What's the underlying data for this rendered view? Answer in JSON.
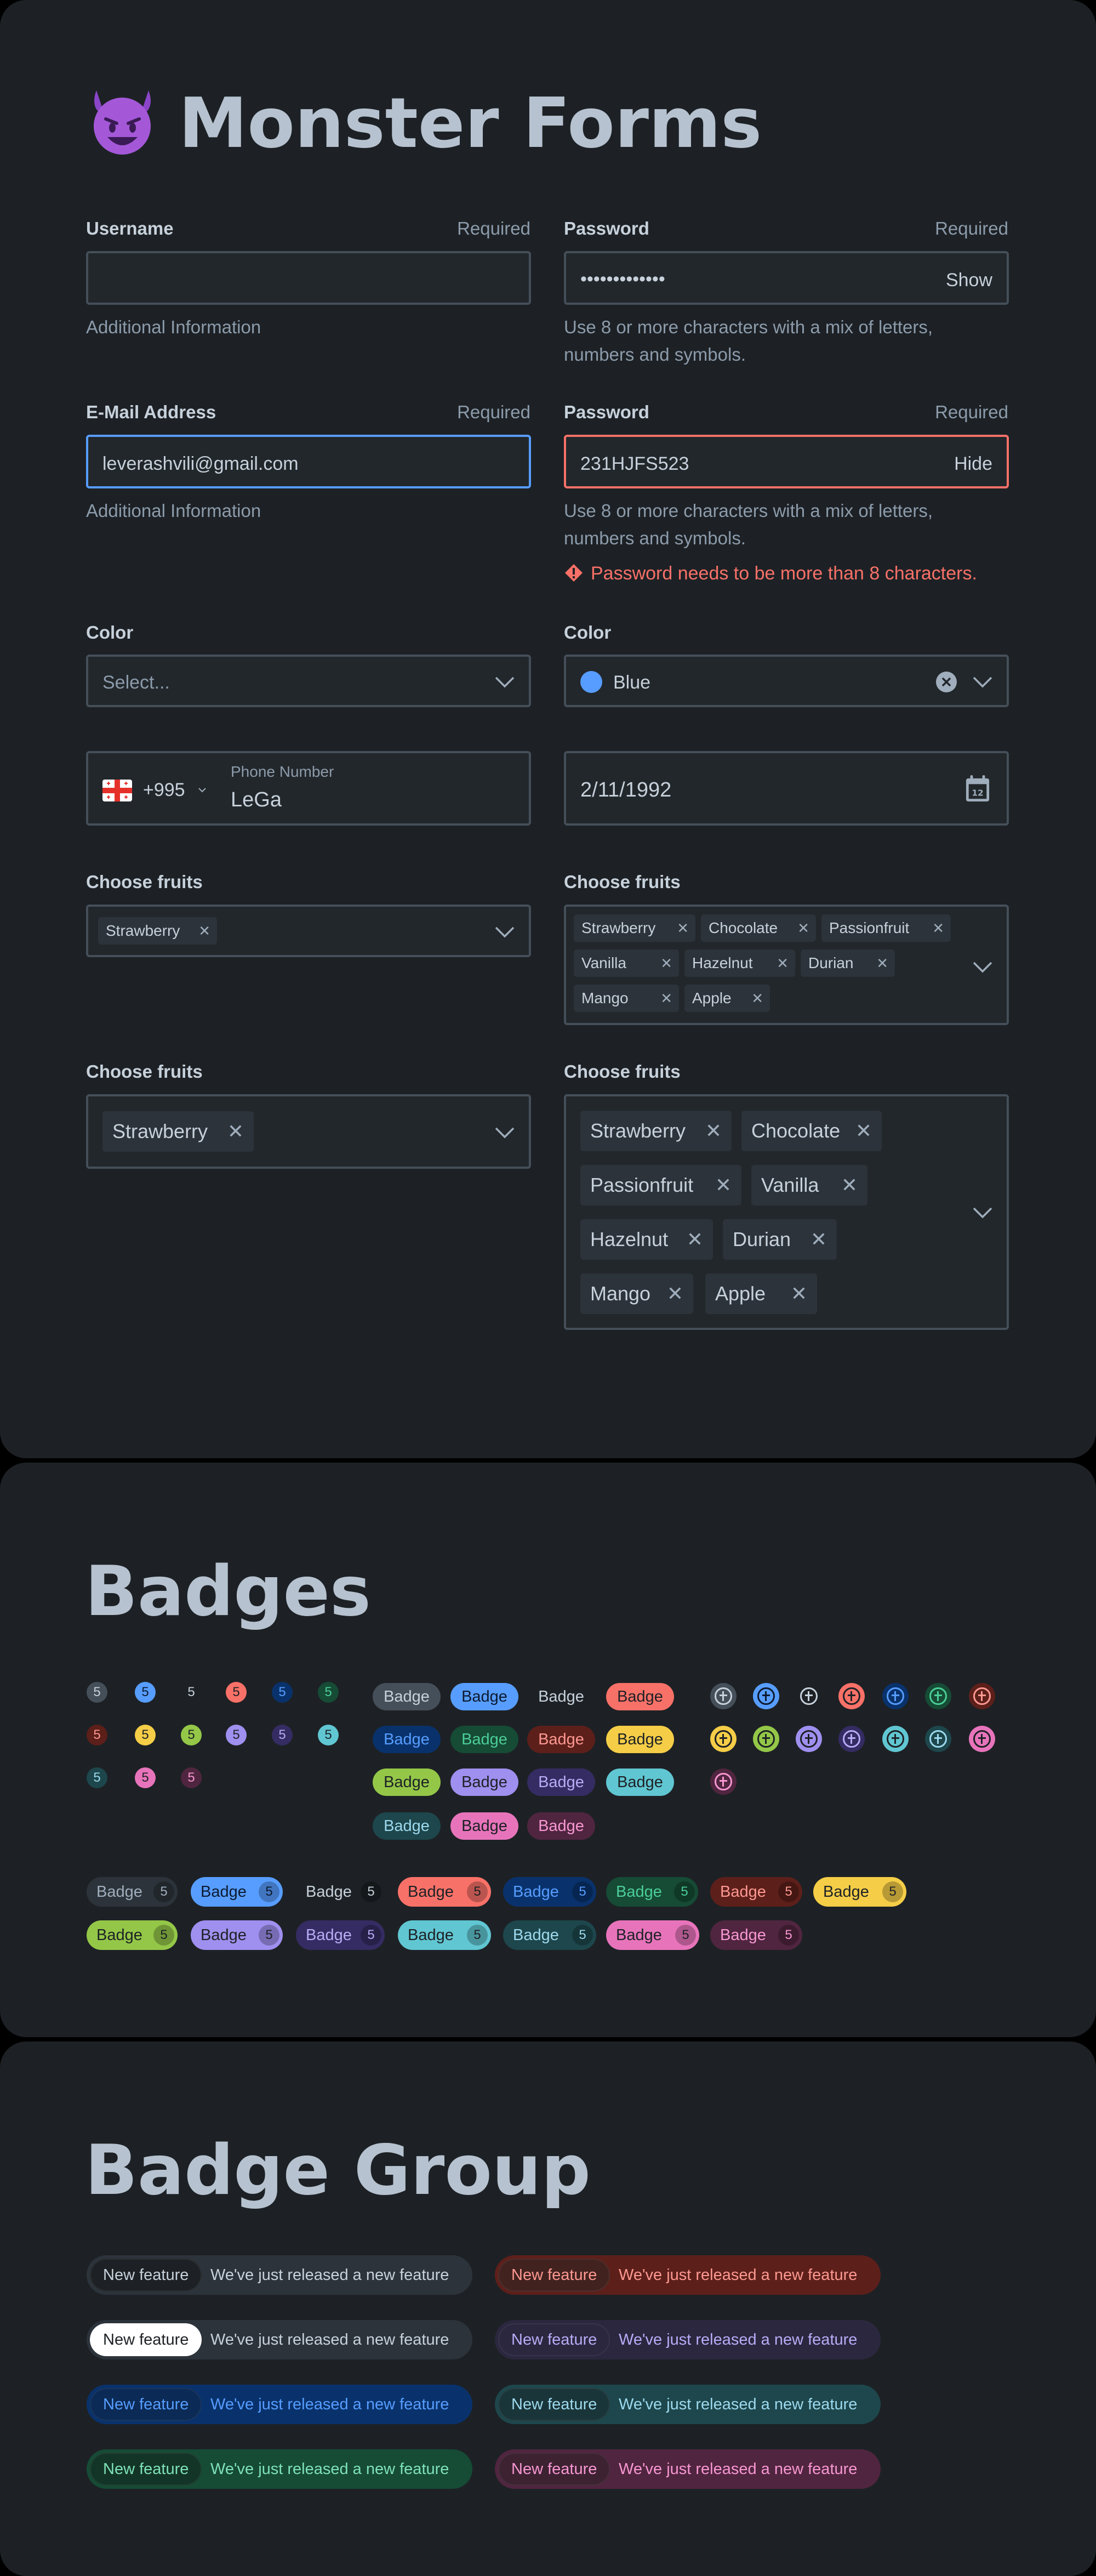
{
  "forms": {
    "title": "Monster Forms",
    "username": {
      "label": "Username",
      "required": "Required",
      "value": "",
      "help": "Additional Information"
    },
    "password1": {
      "label": "Password",
      "required": "Required",
      "value": "•••••••••••••",
      "toggle": "Show",
      "help": "Use 8 or more characters with a mix of letters, numbers and symbols."
    },
    "email": {
      "label": "E-Mail Address",
      "required": "Required",
      "value": "leverashvili@gmail.com",
      "help": "Additional Information"
    },
    "password2": {
      "label": "Password",
      "required": "Required",
      "value": "231HJFS523",
      "toggle": "Hide",
      "help": "Use 8 or more characters with a mix of letters, numbers and symbols.",
      "error": "Password needs to be more than 8 characters."
    },
    "color1": {
      "label": "Color",
      "placeholder": "Select..."
    },
    "color2": {
      "label": "Color",
      "value": "Blue",
      "swatch": "#579dff"
    },
    "phone": {
      "country_code": "+995",
      "label": "Phone Number",
      "value": "LeGa"
    },
    "date": {
      "value": "2/11/1992",
      "icon_day": "12"
    },
    "fruits_sm_single": {
      "label": "Choose fruits",
      "tags": [
        "Strawberry"
      ]
    },
    "fruits_sm_multi": {
      "label": "Choose fruits",
      "tags": [
        "Strawberry",
        "Chocolate",
        "Passionfruit",
        "Vanilla",
        "Hazelnut",
        "Durian",
        "Mango",
        "Apple"
      ]
    },
    "fruits_lg_single": {
      "label": "Choose fruits",
      "tags": [
        "Strawberry"
      ]
    },
    "fruits_lg_multi": {
      "label": "Choose fruits",
      "tags": [
        "Strawberry",
        "Chocolate",
        "Passionfruit",
        "Vanilla",
        "Hazelnut",
        "Durian",
        "Mango",
        "Apple"
      ]
    }
  },
  "badges": {
    "title": "Badges",
    "count": "5",
    "label": "Badge"
  },
  "badge_group": {
    "title": "Badge Group",
    "lead": "New feature",
    "message": "We've just released a new feature"
  },
  "colors": {
    "background": "#1d2125",
    "neutral": "#2c333a",
    "blue": "#579dff",
    "red": "#f87168",
    "yellow": "#f5cd47",
    "green": "#94c748",
    "purple": "#9f8fef",
    "teal": "#60c6d2",
    "magenta": "#e774bb"
  }
}
